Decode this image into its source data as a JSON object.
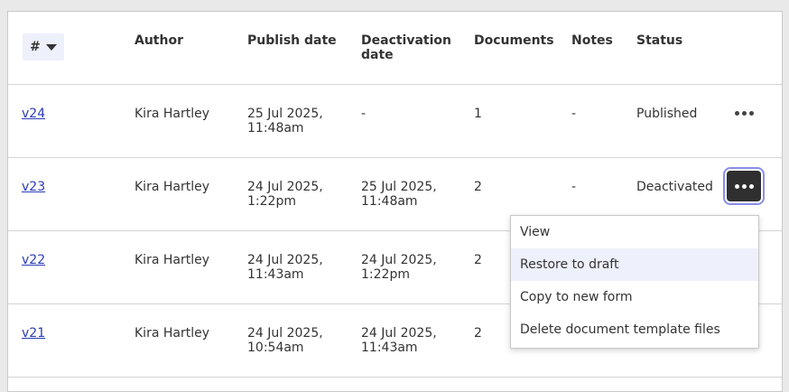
{
  "table": {
    "headers": {
      "num": "#",
      "author": "Author",
      "publish_date": "Publish date",
      "deactivation_date_1": "Deactivation",
      "deactivation_date_2": "date",
      "documents": "Documents",
      "notes": "Notes",
      "status": "Status"
    },
    "rows": [
      {
        "version": "v24",
        "author": "Kira Hartley",
        "publish_1": "25 Jul 2025,",
        "publish_2": "11:48am",
        "deact_1": "-",
        "deact_2": "",
        "documents": "1",
        "notes": "-",
        "status": "Published"
      },
      {
        "version": "v23",
        "author": "Kira Hartley",
        "publish_1": "24 Jul 2025,",
        "publish_2": "1:22pm",
        "deact_1": "25 Jul 2025,",
        "deact_2": "11:48am",
        "documents": "2",
        "notes": "-",
        "status": "Deactivated"
      },
      {
        "version": "v22",
        "author": "Kira Hartley",
        "publish_1": "24 Jul 2025,",
        "publish_2": "11:43am",
        "deact_1": "24 Jul 2025,",
        "deact_2": "1:22pm",
        "documents": "2",
        "notes": "",
        "status": ""
      },
      {
        "version": "v21",
        "author": "Kira Hartley",
        "publish_1": "24 Jul 2025,",
        "publish_2": "10:54am",
        "deact_1": "24 Jul 2025,",
        "deact_2": "11:43am",
        "documents": "2",
        "notes": "",
        "status": ""
      }
    ]
  },
  "menu": {
    "items": [
      "View",
      "Restore to draft",
      "Copy to new form",
      "Delete document template files"
    ],
    "highlighted_index": 1
  },
  "icons": {
    "sort": "caret-down-icon",
    "actions": "more-horizontal-icon"
  },
  "colors": {
    "link": "#2a3bb5",
    "active_button": "#2f2f2f",
    "focus_ring": "#8a8ee8",
    "menu_highlight": "#eef0fb"
  }
}
